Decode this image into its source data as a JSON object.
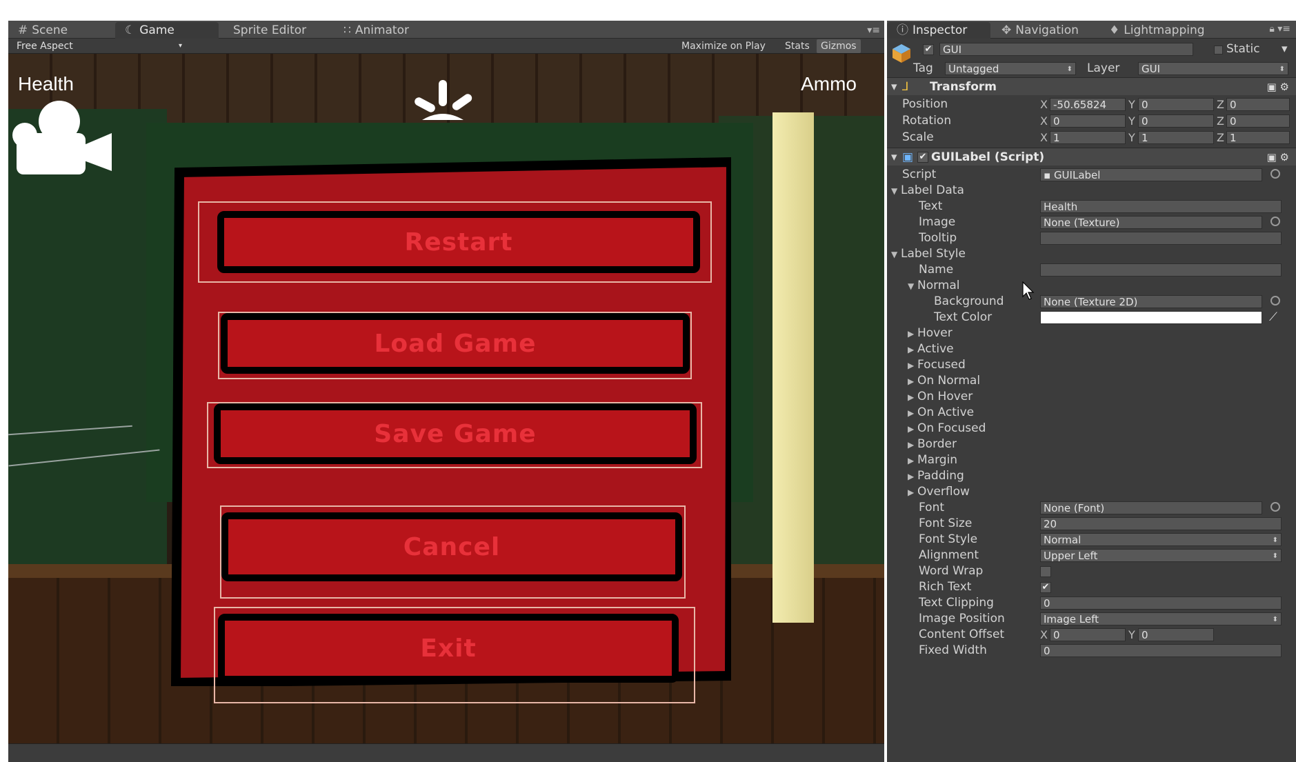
{
  "left_tabs": [
    {
      "icon": "#",
      "label": "Scene"
    },
    {
      "icon": "☾",
      "label": "Game"
    },
    {
      "icon": "",
      "label": "Sprite Editor"
    },
    {
      "icon": "∷",
      "label": "Animator"
    }
  ],
  "game_toolbar": {
    "aspect": "Free Aspect",
    "maximize": "Maximize on Play",
    "stats": "Stats",
    "gizmos": "Gizmos"
  },
  "hud": {
    "health": "Health",
    "ammo": "Ammo"
  },
  "menu": {
    "restart": "Restart",
    "load": "Load Game",
    "save": "Save Game",
    "cancel": "Cancel",
    "exit": "Exit"
  },
  "inspector": {
    "tabs": {
      "inspector": "Inspector",
      "navigation": "Navigation",
      "lightmapping": "Lightmapping"
    },
    "object": {
      "name": "GUI",
      "static": "Static",
      "tag_label": "Tag",
      "tag": "Untagged",
      "layer_label": "Layer",
      "layer": "GUI"
    },
    "transform": {
      "title": "Transform",
      "position": {
        "label": "Position",
        "x": "-50.65824",
        "y": "0",
        "z": "0"
      },
      "rotation": {
        "label": "Rotation",
        "x": "0",
        "y": "0",
        "z": "0"
      },
      "scale": {
        "label": "Scale",
        "x": "1",
        "y": "1",
        "z": "1"
      }
    },
    "guilabel": {
      "title": "GUILabel (Script)",
      "script_label": "Script",
      "script": "GUILabel",
      "label_data": "Label Data",
      "text_label": "Text",
      "text": "Health",
      "image_label": "Image",
      "image": "None (Texture)",
      "tooltip_label": "Tooltip",
      "label_style": "Label Style",
      "name_label": "Name",
      "normal": "Normal",
      "background_label": "Background",
      "background": "None (Texture 2D)",
      "text_color_label": "Text Color",
      "text_color": "#ffffff",
      "collapsed": [
        "Hover",
        "Active",
        "Focused",
        "On Normal",
        "On Hover",
        "On Active",
        "On Focused",
        "Border",
        "Margin",
        "Padding",
        "Overflow"
      ],
      "font_label": "Font",
      "font": "None (Font)",
      "font_size_label": "Font Size",
      "font_size": "20",
      "font_style_label": "Font Style",
      "font_style": "Normal",
      "alignment_label": "Alignment",
      "alignment": "Upper Left",
      "word_wrap_label": "Word Wrap",
      "rich_text_label": "Rich Text",
      "text_clipping_label": "Text Clipping",
      "text_clipping": "0",
      "image_position_label": "Image Position",
      "image_position": "Image Left",
      "content_offset_label": "Content Offset",
      "content_offset_x": "0",
      "content_offset_y": "0",
      "fixed_width_label": "Fixed Width",
      "fixed_width": "0"
    }
  }
}
